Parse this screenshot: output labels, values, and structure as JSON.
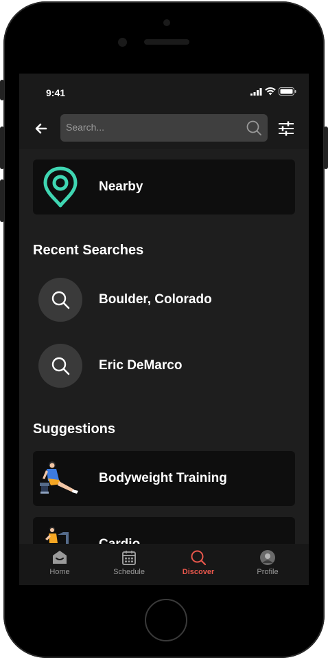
{
  "status_bar": {
    "time": "9:41"
  },
  "search": {
    "placeholder": "Search..."
  },
  "nearby": {
    "label": "Nearby"
  },
  "recent": {
    "title": "Recent Searches",
    "items": [
      {
        "label": "Boulder, Colorado"
      },
      {
        "label": "Eric DeMarco"
      }
    ]
  },
  "suggestions": {
    "title": "Suggestions",
    "items": [
      {
        "label": "Bodyweight Training"
      },
      {
        "label": "Cardio"
      }
    ]
  },
  "tabs": [
    {
      "label": "Home"
    },
    {
      "label": "Schedule"
    },
    {
      "label": "Discover"
    },
    {
      "label": "Profile"
    }
  ],
  "colors": {
    "accent": "#e8574c",
    "pin": "#3fd6b2",
    "background": "#1e1e1e",
    "card": "#0e0e0e"
  }
}
